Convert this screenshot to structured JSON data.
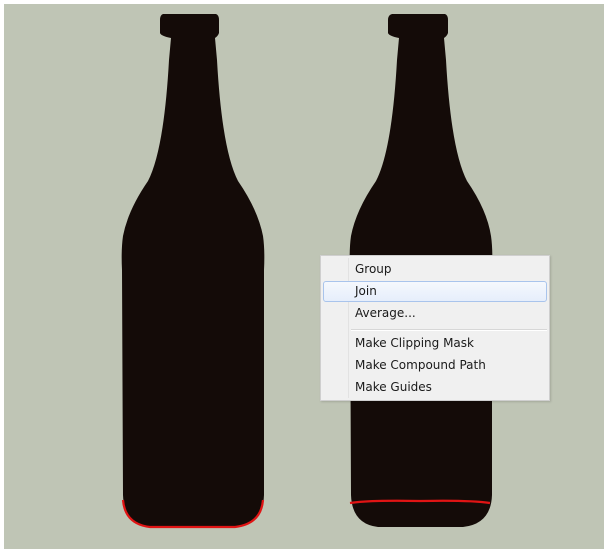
{
  "canvas": {
    "background_color": "#bfc5b5",
    "bottle_color": "#140b08",
    "path_highlight_color": "#e01414"
  },
  "context_menu": {
    "items": [
      {
        "label": "Group",
        "highlighted": false
      },
      {
        "label": "Join",
        "highlighted": true
      },
      {
        "label": "Average...",
        "highlighted": false
      },
      {
        "label": "Make Clipping Mask",
        "highlighted": false
      },
      {
        "label": "Make Compound Path",
        "highlighted": false
      },
      {
        "label": "Make Guides",
        "highlighted": false
      }
    ]
  }
}
